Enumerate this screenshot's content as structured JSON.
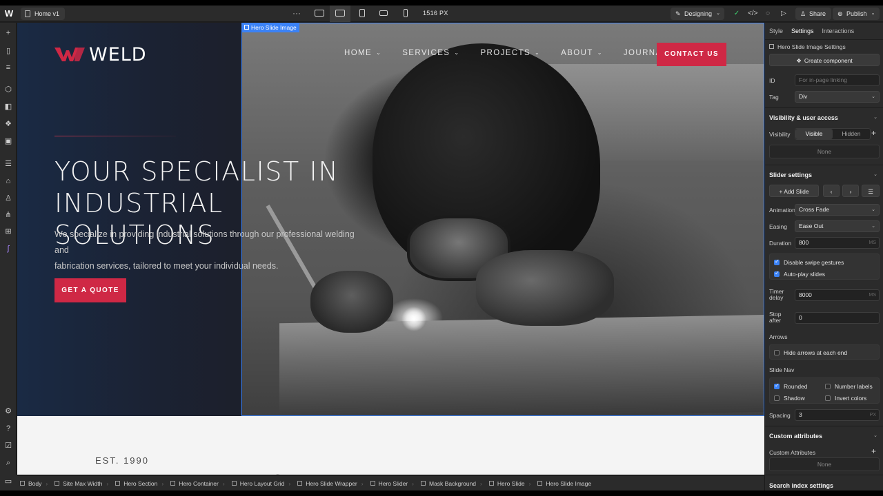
{
  "toolbar": {
    "page_name": "Home v1",
    "canvas_width": "1516 PX",
    "mode": "Designing",
    "share": "Share",
    "publish": "Publish"
  },
  "site": {
    "brand": "WELD",
    "nav": [
      "HOME",
      "SERVICES",
      "PROJECTS",
      "ABOUT",
      "JOURNAL"
    ],
    "contact": "CONTACT US",
    "headline_line1": "YOUR SPECIALIST IN",
    "headline_line2": "INDUSTRIAL SOLUTIONS",
    "subtext_line1": "We specialize in providing industrial solutions through our professional welding and",
    "subtext_line2": "fabrication services, tailored to meet your individual needs.",
    "quote_btn": "GET A QUOTE",
    "est": "EST. 1990",
    "selection_tag": "Hero Slide Image",
    "accent": "#cf2845"
  },
  "breadcrumbs": [
    "Body",
    "Site Max Width",
    "Hero Section",
    "Hero Container",
    "Hero Layout Grid",
    "Hero Slide Wrapper",
    "Hero Slider",
    "Mask Background",
    "Hero Slide",
    "Hero Slide Image"
  ],
  "panel": {
    "tabs": [
      "Style",
      "Settings",
      "Interactions"
    ],
    "settings_title": "Hero Slide Image Settings",
    "create_component": "Create component",
    "id_label": "ID",
    "id_placeholder": "For in-page linking",
    "tag_label": "Tag",
    "tag_value": "Div",
    "visibility_head": "Visibility & user access",
    "visibility_label": "Visibility",
    "visible": "Visible",
    "hidden": "Hidden",
    "none": "None",
    "slider_head": "Slider settings",
    "add_slide": "Add Slide",
    "animation_label": "Animation",
    "animation_value": "Cross Fade",
    "easing_label": "Easing",
    "easing_value": "Ease Out",
    "duration_label": "Duration",
    "duration_value": "800",
    "unit_ms": "MS",
    "disable_swipe": "Disable swipe gestures",
    "autoplay": "Auto-play slides",
    "timer_label_1": "Timer",
    "timer_label_2": "delay",
    "timer_value": "8000",
    "stop_label_1": "Stop",
    "stop_label_2": "after",
    "stop_value": "0",
    "arrows_label": "Arrows",
    "hide_arrows": "Hide arrows at each end",
    "slide_nav_label": "Slide Nav",
    "rounded": "Rounded",
    "number_labels": "Number labels",
    "shadow": "Shadow",
    "invert": "Invert colors",
    "spacing_label": "Spacing",
    "spacing_value": "3",
    "unit_px": "PX",
    "custom_attr_head": "Custom attributes",
    "custom_attr_label": "Custom Attributes",
    "search_head": "Search index settings"
  }
}
